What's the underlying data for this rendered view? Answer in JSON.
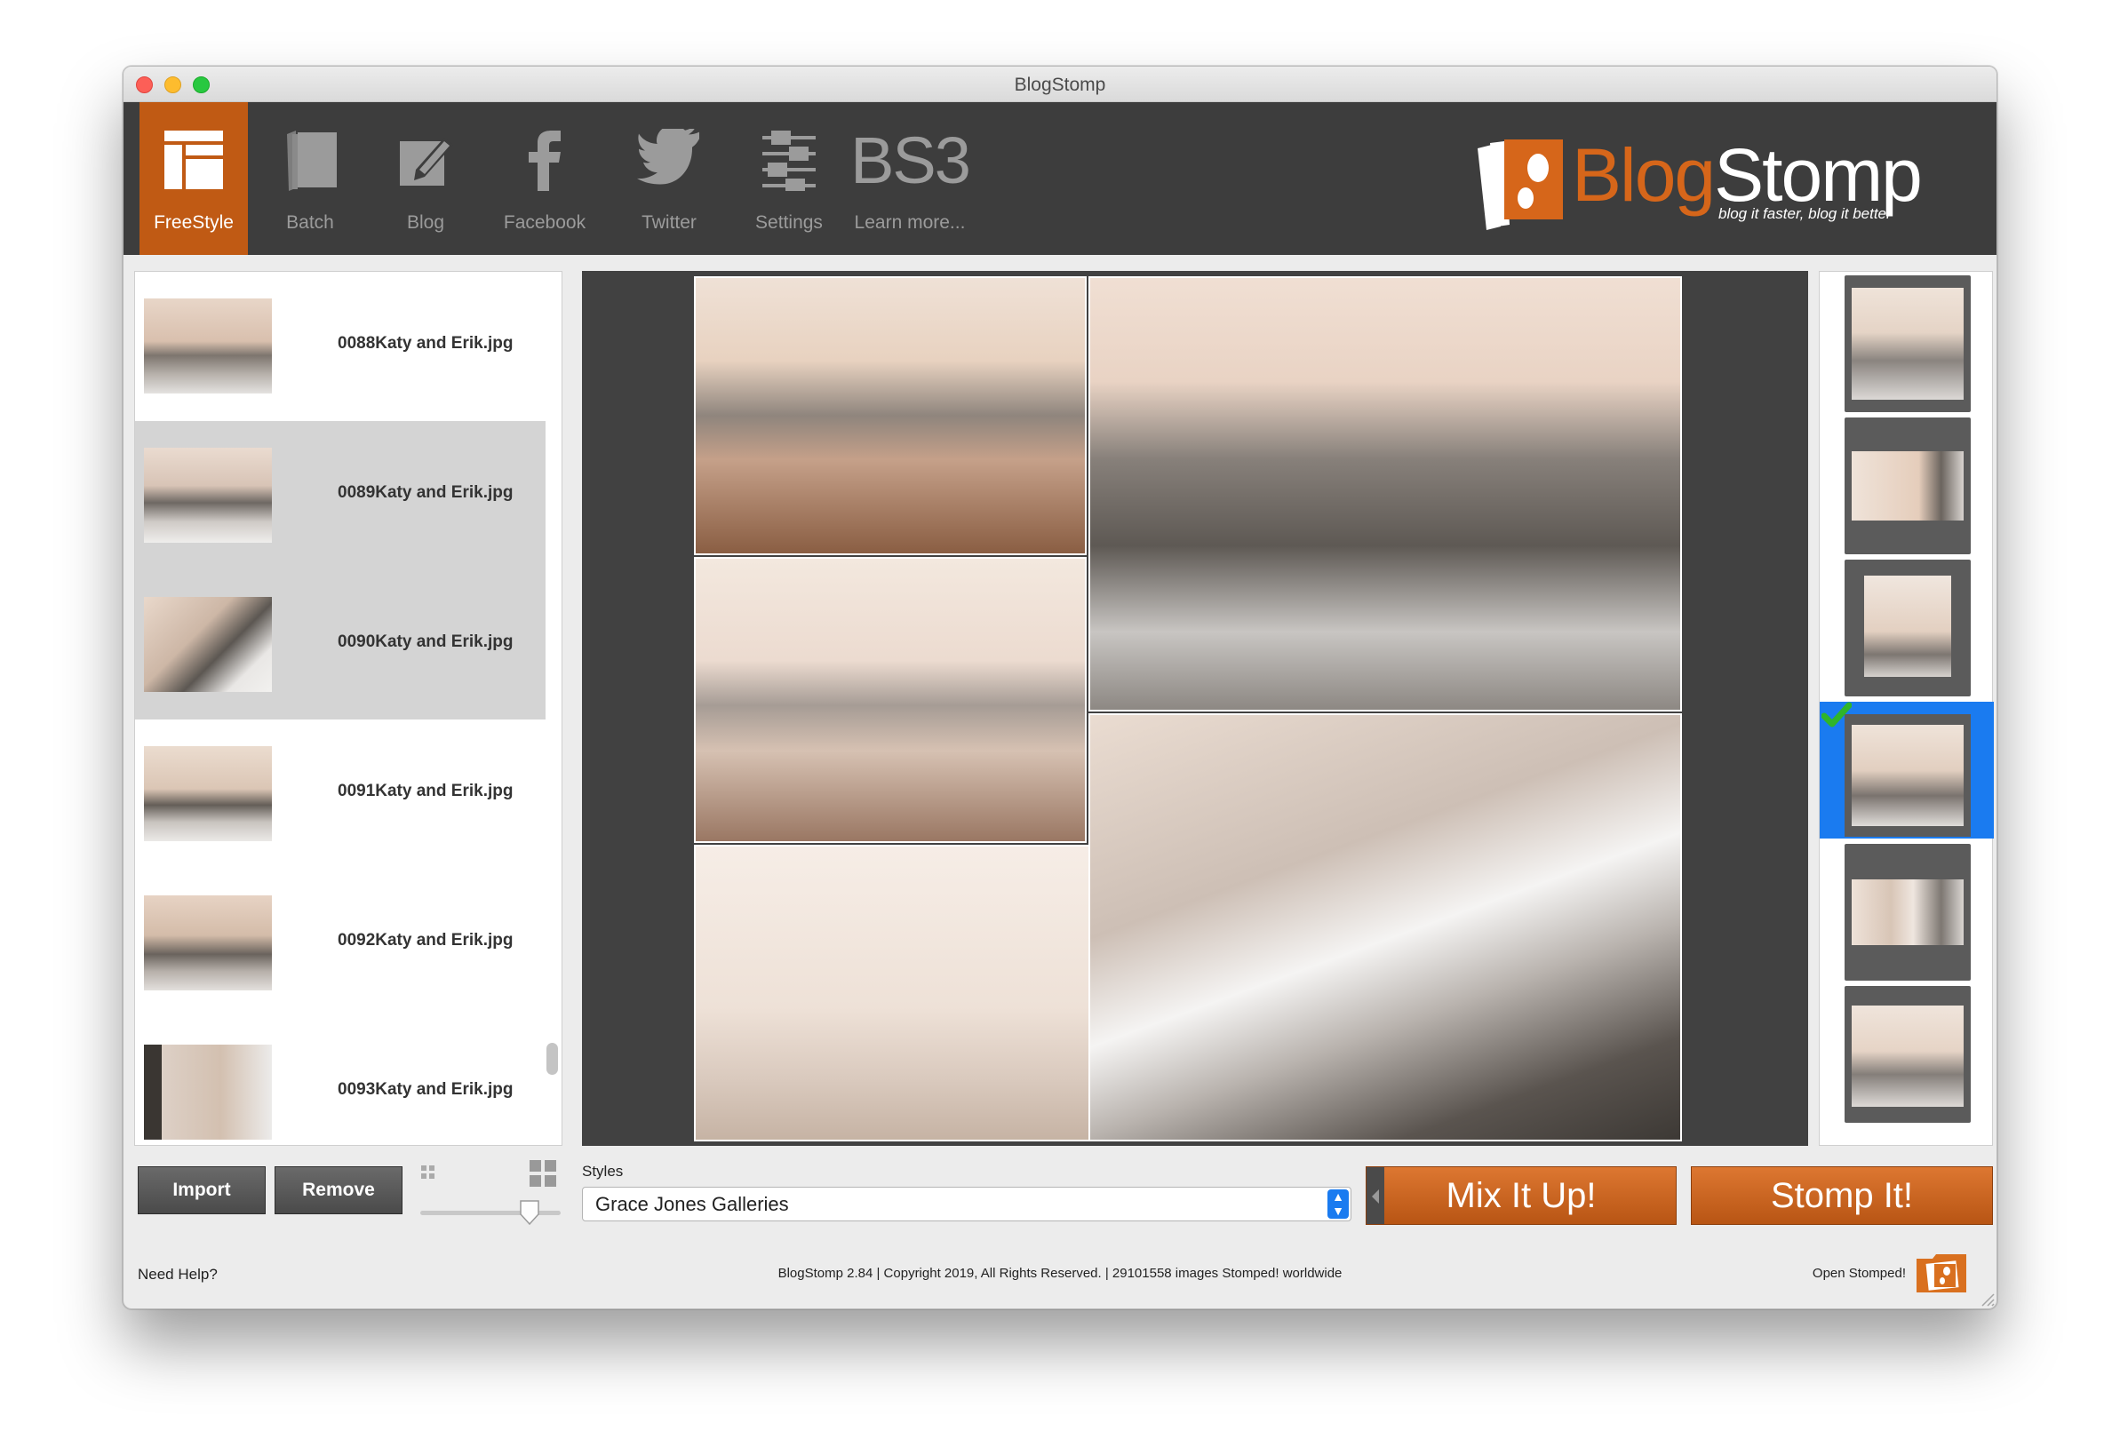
{
  "window": {
    "title": "BlogStomp"
  },
  "toolbar": {
    "items": [
      {
        "label": "FreeStyle",
        "icon": "freestyle-layout-icon",
        "active": true
      },
      {
        "label": "Batch",
        "icon": "batch-stack-icon"
      },
      {
        "label": "Blog",
        "icon": "blog-pen-icon"
      },
      {
        "label": "Facebook",
        "icon": "facebook-icon"
      },
      {
        "label": "Twitter",
        "icon": "twitter-bird-icon"
      },
      {
        "label": "Settings",
        "icon": "settings-sliders-icon"
      },
      {
        "label": "Learn more...",
        "icon": "bs3-icon",
        "icon_text": "BS3"
      }
    ],
    "logo": {
      "brand_a": "Blog",
      "brand_b": "Stomp",
      "tagline": "blog it faster, blog it better"
    }
  },
  "files": [
    {
      "name": "0088Katy and Erik.jpg",
      "selected": false
    },
    {
      "name": "0089Katy and Erik.jpg",
      "selected": true
    },
    {
      "name": "0090Katy and Erik.jpg",
      "selected": true
    },
    {
      "name": "0091Katy and Erik.jpg",
      "selected": false
    },
    {
      "name": "0092Katy and Erik.jpg",
      "selected": false
    },
    {
      "name": "0093Katy and Erik.jpg",
      "selected": false
    }
  ],
  "buttons": {
    "import": "Import",
    "remove": "Remove",
    "mix": "Mix It Up!",
    "stomp": "Stomp It!"
  },
  "styles": {
    "label": "Styles",
    "selected": "Grace Jones Galleries"
  },
  "footer": {
    "help": "Need Help?",
    "copyright": "BlogStomp 2.84 | Copyright 2019, All Rights Reserved. | 29101558 images Stomped! worldwide",
    "open_stomped": "Open Stomped!"
  },
  "colors": {
    "accent": "#c05a14",
    "toolbar_bg": "#3d3d3d",
    "selection": "#1a7bf0",
    "canvas_bg": "#414141"
  }
}
